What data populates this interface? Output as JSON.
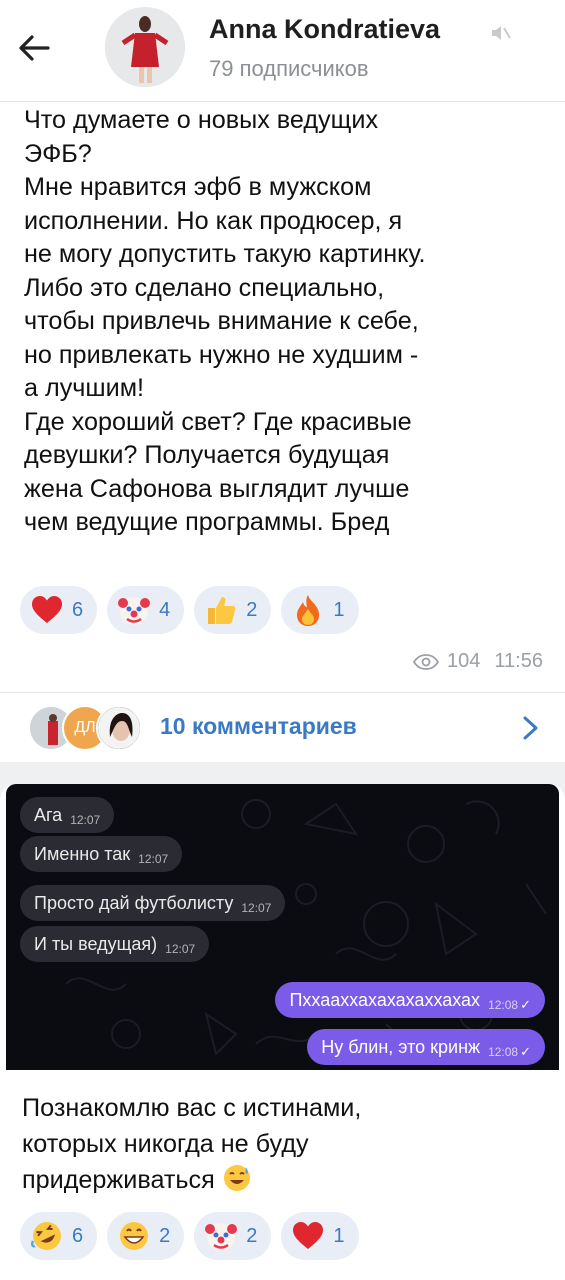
{
  "header": {
    "title": "Anna Kondratieva",
    "subtitle": "79 подписчиков"
  },
  "post1": {
    "text": "Что думаете о новых ведущих\nЭФБ?\nМне нравится эфб в мужском\nисполнении. Но как продюсер, я\nне могу допустить такую картинку.\nЛибо это сделано специально,\nчтобы привлечь внимание к себе,\nно привлекать нужно не худшим -\nа лучшим!\nГде хороший свет? Где красивые\nдевушки? Получается будущая\nжена Сафонова выглядит лучше\nчем ведущие программы. Бред",
    "reactions": [
      {
        "icon": "heart-emoji",
        "count": "6"
      },
      {
        "icon": "clown-emoji",
        "count": "4"
      },
      {
        "icon": "thumbs-up-emoji",
        "count": "2"
      },
      {
        "icon": "fire-emoji",
        "count": "1"
      }
    ],
    "views": "104",
    "time": "11:56",
    "comments": {
      "label": "10 комментариев",
      "avatar2_initials": "ДЛ"
    }
  },
  "post2": {
    "chat": [
      {
        "dir": "in",
        "text": "Ага",
        "time": "12:07"
      },
      {
        "dir": "in",
        "text": "Именно так",
        "time": "12:07"
      },
      {
        "dir": "in",
        "text": "Просто дай футболисту",
        "time": "12:07"
      },
      {
        "dir": "in",
        "text": "И ты ведущая)",
        "time": "12:07"
      },
      {
        "dir": "out",
        "text": "Пххааххахахахаххахах",
        "time": "12:08"
      },
      {
        "dir": "out",
        "text": "Ну блин, это кринж",
        "time": "12:08"
      }
    ],
    "text": "Познакомлю вас с истинами,\nкоторых никогда не буду\nпридерживаться",
    "reactions": [
      {
        "icon": "rofl-emoji",
        "count": "6"
      },
      {
        "icon": "grin-emoji",
        "count": "2"
      },
      {
        "icon": "clown-emoji",
        "count": "2"
      },
      {
        "icon": "heart-emoji",
        "count": "1"
      }
    ]
  },
  "colors": {
    "accent": "#3a79c4",
    "reaction_bg": "#e9eef6",
    "outgoing_bubble": "#7b5ce8",
    "incoming_bubble": "#2b2c33"
  }
}
